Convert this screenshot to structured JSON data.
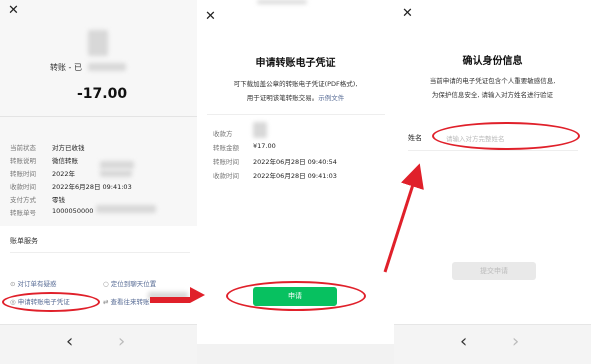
{
  "panel1": {
    "top_text": "转账 - 已",
    "amount": "-17.00",
    "details": [
      {
        "label": "当前状态",
        "value": "对方已收钱"
      },
      {
        "label": "转账说明",
        "value": "微信转账"
      },
      {
        "label": "转账时间",
        "value": "2022年"
      },
      {
        "label": "收款时间",
        "value": "2022年6月28日 09:41:03"
      },
      {
        "label": "支付方式",
        "value": "零钱"
      },
      {
        "label": "转账单号",
        "value": "1000050000"
      }
    ],
    "service_title": "账单服务",
    "services": [
      "对订单有疑惑",
      "定位到聊天位置",
      "申请转账电子凭证",
      "查看往来转账"
    ]
  },
  "panel2": {
    "title": "申请转账电子凭证",
    "desc_line1": "可下载加盖公章的转账电子凭证(PDF格式),",
    "desc_line2": "用于证明该笔转账交易。",
    "sample_link": "示例文件",
    "rows": [
      {
        "label": "收款方",
        "value": ""
      },
      {
        "label": "转账金额",
        "value": "¥17.00"
      },
      {
        "label": "转账时间",
        "value": "2022年06月28日 09:40:54"
      },
      {
        "label": "收款时间",
        "value": "2022年06月28日 09:41:03"
      }
    ],
    "apply_button": "申请"
  },
  "panel3": {
    "title": "确认身份信息",
    "desc_line1": "当前申请的电子凭证包含个人重要敏感信息,",
    "desc_line2": "为保护信息安全, 请输入对方姓名进行验证",
    "name_label": "姓名",
    "name_placeholder": "请输入对方完整姓名",
    "submit_button": "提交申请"
  },
  "nav": {
    "back": "‹",
    "forward": "›"
  },
  "close_glyph": "✕",
  "colors": {
    "accent": "#07c160",
    "link": "#576b95",
    "annotation": "#e0202a"
  }
}
